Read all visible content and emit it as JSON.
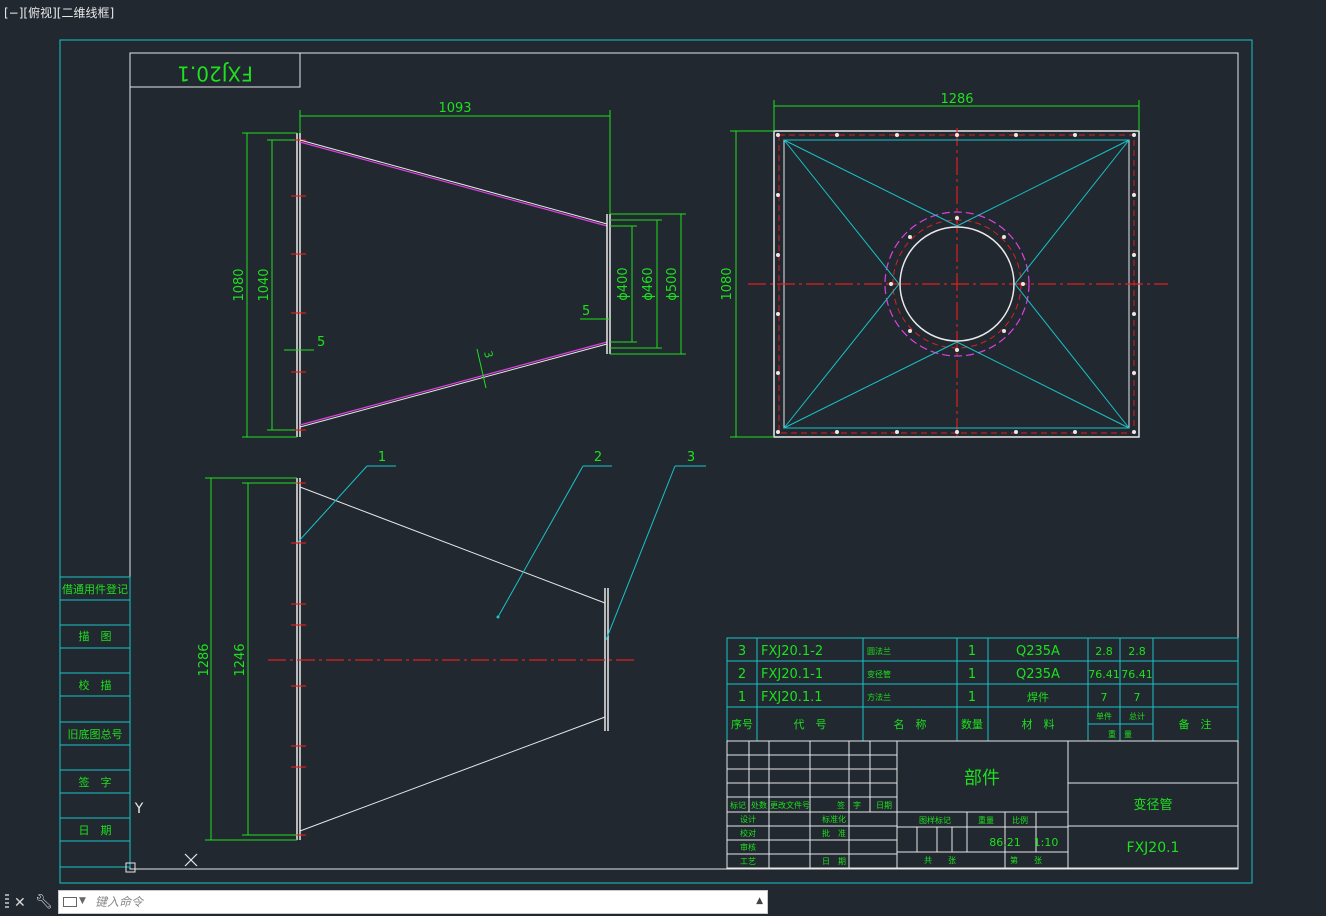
{
  "viewport": {
    "label": "[−][俯视][二维线框]"
  },
  "drawing": {
    "number_mirrored": "FXJ20.1",
    "dims": {
      "front_length": "1093",
      "front_h_outer": "1080",
      "front_h_inner": "1040",
      "thk_left": "5",
      "thk_right": "5",
      "d400": "ϕ400",
      "d460": "ϕ460",
      "d500": "ϕ500",
      "wall_thk": "3",
      "top_width": "1286",
      "top_height": "1080",
      "asm_h_outer": "1286",
      "asm_h_inner": "1246"
    },
    "balloons": [
      "1",
      "2",
      "3"
    ],
    "side_table": [
      "借通用件登记",
      "描　图",
      "校　描",
      "旧底图总号",
      "签　字",
      "日　期"
    ]
  },
  "bom": {
    "rows": [
      {
        "seq": "3",
        "code": "FXJ20.1-2",
        "name": "圆法兰",
        "qty": "1",
        "material": "Q235A",
        "unit_wt": "2.8",
        "total_wt": "2.8"
      },
      {
        "seq": "2",
        "code": "FXJ20.1-1",
        "name": "变径管",
        "qty": "1",
        "material": "Q235A",
        "unit_wt": "76.41",
        "total_wt": "76.41"
      },
      {
        "seq": "1",
        "code": "FXJ20.1.1",
        "name": "方法兰",
        "qty": "1",
        "material": "焊件",
        "unit_wt": "7",
        "total_wt": "7"
      }
    ],
    "header": {
      "seq": "序号",
      "code": "代　号",
      "name": "名　称",
      "qty": "数量",
      "material": "材　料",
      "unit": "单件",
      "total": "总计",
      "weight": "重　量",
      "remark": "备　注"
    }
  },
  "titleblock": {
    "category": "部件",
    "name": "变径管",
    "drawing_no": "FXJ20.1",
    "rev_labels": [
      "标记",
      "处数",
      "更改文件号",
      "签　字",
      "日期"
    ],
    "roles": [
      "设计",
      "校对",
      "审核",
      "工艺"
    ],
    "roles2": [
      "标准化",
      "批　准",
      "日　期"
    ],
    "stage_label": "图样标记",
    "weight_label": "重量",
    "scale_label": "比例",
    "weight": "86.21",
    "scale": "1:10",
    "sheets_total": "共　　张",
    "sheet_no": "第　　张"
  },
  "ucs": {
    "y": "Y"
  },
  "command": {
    "placeholder": "键入命令"
  },
  "colors": {
    "background": "#212830",
    "cyan": "#19c3c8",
    "green": "#1ee01e",
    "red": "#e01e1e",
    "white": "#e8e8e8",
    "magenta": "#e040e0"
  }
}
